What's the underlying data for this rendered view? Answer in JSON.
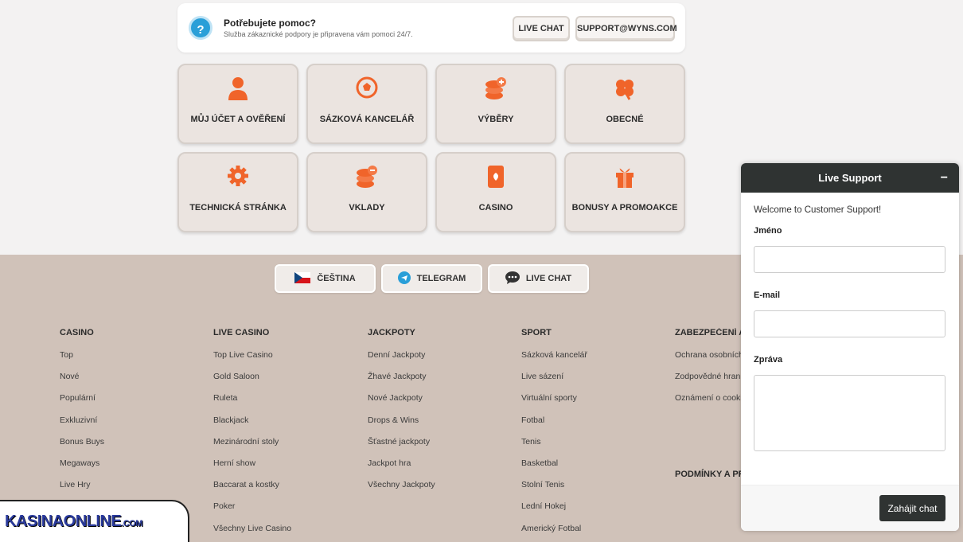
{
  "help": {
    "title": "Potřebujete pomoc?",
    "subtitle": "Služba zákaznické podpory je připravena vám pomoci 24/7.",
    "live_chat": "LIVE CHAT",
    "email": "SUPPORT@WYNS.COM"
  },
  "categories": [
    {
      "label": "MŮJ ÚČET A OVĚŘENÍ",
      "icon": "user-icon"
    },
    {
      "label": "SÁZKOVÁ KANCELÁŘ",
      "icon": "football-icon"
    },
    {
      "label": "VÝBĚRY",
      "icon": "coins-plus-icon"
    },
    {
      "label": "OBECNÉ",
      "icon": "clover-icon"
    },
    {
      "label": "TECHNICKÁ STRÁNKA",
      "icon": "gear-icon"
    },
    {
      "label": "VKLADY",
      "icon": "coins-minus-icon"
    },
    {
      "label": "CASINO",
      "icon": "card-icon"
    },
    {
      "label": "BONUSY A PROMOAKCE",
      "icon": "gift-icon"
    }
  ],
  "footer_buttons": {
    "language": "ČEŠTINA",
    "telegram": "TELEGRAM",
    "live_chat": "LIVE CHAT"
  },
  "columns": [
    {
      "title": "CASINO",
      "links": [
        "Top",
        "Nové",
        "Populární",
        "Exkluzivní",
        "Bonus Buys",
        "Megaways",
        "Live Hry"
      ]
    },
    {
      "title": "LIVE CASINO",
      "links": [
        "Top Live Casino",
        "Gold Saloon",
        "Ruleta",
        "Blackjack",
        "Mezinárodní stoly",
        "Herní show",
        "Baccarat a kostky",
        "Poker",
        "Všechny Live Casino"
      ]
    },
    {
      "title": "JACKPOTY",
      "links": [
        "Denní Jackpoty",
        "Žhavé Jackpoty",
        "Nové Jackpoty",
        "Drops & Wins",
        "Šťastné jackpoty",
        "Jackpot hra",
        "Všechny Jackpoty"
      ]
    },
    {
      "title": "SPORT",
      "links": [
        "Sázková kancelář",
        "Live sázení",
        "Virtuální sporty",
        "Fotbal",
        "Tenis",
        "Basketbal",
        "Stolní Tenis",
        "Lední Hokej",
        "Americký Fotbal"
      ]
    },
    {
      "title": "ZABEZPEČENÍ A SO",
      "links": [
        "Ochrana osobních úd",
        "Zodpovědné hraní",
        "Oznámení o cookie"
      ]
    }
  ],
  "extra_heading": "PODMÍNKY A PRAV",
  "logo": {
    "main": "KASINAONLINE",
    "suffix": ".COM"
  },
  "chat": {
    "header": "Live Support",
    "minimize": "−",
    "welcome": "Welcome to Customer Support!",
    "name_label": "Jméno",
    "email_label": "E-mail",
    "message_label": "Zpráva",
    "start_button": "Zahájit chat"
  },
  "colors": {
    "accent": "#f0642a",
    "chat_dark": "#2f3332",
    "footer_bg": "#d0c2b9",
    "help_blue": "#2a9fd8"
  }
}
